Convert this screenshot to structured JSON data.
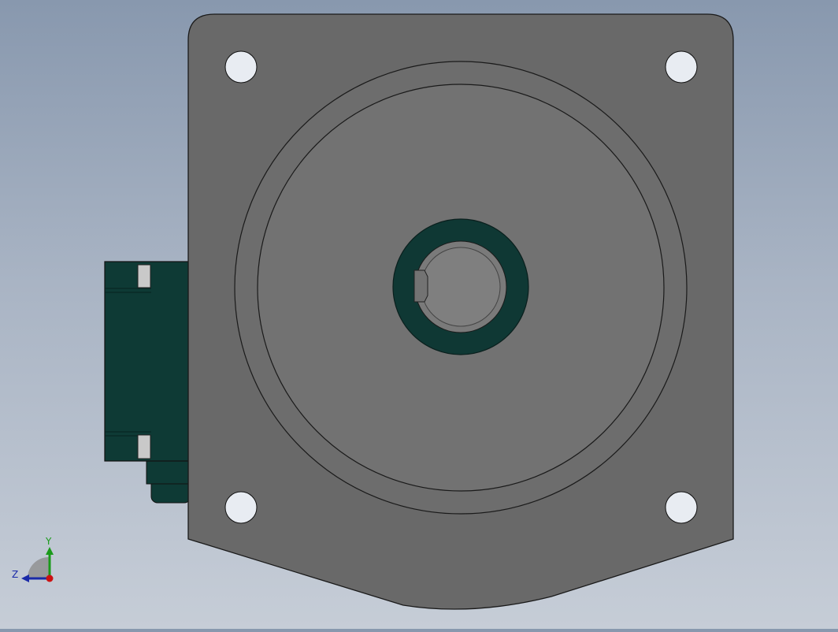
{
  "viewport": {
    "background_top": "#8898ae",
    "background_bottom": "#c6cdd7"
  },
  "model": {
    "flange_color": "#696969",
    "face_color": "#727272",
    "edge_color": "#1a1a1a",
    "hole_color": "#e8ecf2",
    "shaft_collar_color": "#0f3834",
    "shaft_color": "#7a7a7a",
    "connector_color": "#0e3a35"
  },
  "triad": {
    "y_label": "Y",
    "z_label": "Z",
    "y_color": "#1a9a1a",
    "z_color": "#1a2aa8",
    "x_color": "#cc1111"
  }
}
